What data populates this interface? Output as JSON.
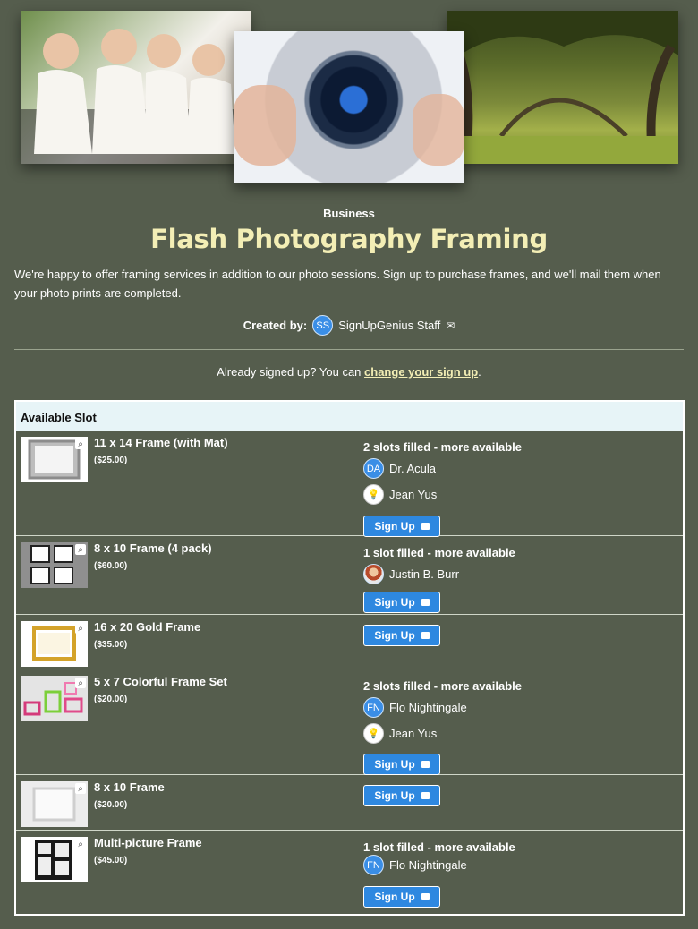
{
  "header": {
    "category": "Business",
    "title": "Flash Photography Framing",
    "description": "We're happy to offer framing services in addition to our photo sessions. Sign up to purchase frames, and we'll mail them when your photo prints are completed.",
    "created_by_label": "Created by:",
    "creator_initials": "SS",
    "creator_name": "SignUpGenius Staff",
    "mail_icon": "mail-icon"
  },
  "already": {
    "prefix": "Already signed up? You can",
    "link": "change your sign up",
    "suffix": "."
  },
  "table": {
    "header": "Available Slot",
    "button_label": "Sign Up",
    "rows": [
      {
        "name": "11 x 14 Frame (with Mat)",
        "price": "($25.00)",
        "status": "2 slots filled - more available",
        "signers": [
          {
            "initials": "DA",
            "name": "Dr. Acula",
            "avatar": "initials"
          },
          {
            "initials": "",
            "name": "Jean Yus",
            "avatar": "lightbulb"
          }
        ]
      },
      {
        "name": "8 x 10 Frame (4 pack)",
        "price": "($60.00)",
        "status": "1 slot filled - more available",
        "signers": [
          {
            "initials": "",
            "name": "Justin B. Burr",
            "avatar": "photo"
          }
        ]
      },
      {
        "name": "16 x 20 Gold Frame",
        "price": "($35.00)",
        "status": "",
        "signers": []
      },
      {
        "name": "5 x 7 Colorful Frame Set",
        "price": "($20.00)",
        "status": "2 slots filled - more available",
        "signers": [
          {
            "initials": "FN",
            "name": "Flo Nightingale",
            "avatar": "initials"
          },
          {
            "initials": "",
            "name": "Jean Yus",
            "avatar": "lightbulb"
          }
        ]
      },
      {
        "name": "8 x 10 Frame",
        "price": "($20.00)",
        "status": "",
        "signers": []
      },
      {
        "name": "Multi-picture Frame",
        "price": "($45.00)",
        "status": "1 slot filled - more available",
        "signers": [
          {
            "initials": "FN",
            "name": "Flo Nightingale",
            "avatar": "initials"
          }
        ]
      }
    ]
  },
  "colors": {
    "background": "#555d4d",
    "title": "#f3eeb5",
    "button": "#2e88e0",
    "table_header": "#e7f4f7"
  }
}
